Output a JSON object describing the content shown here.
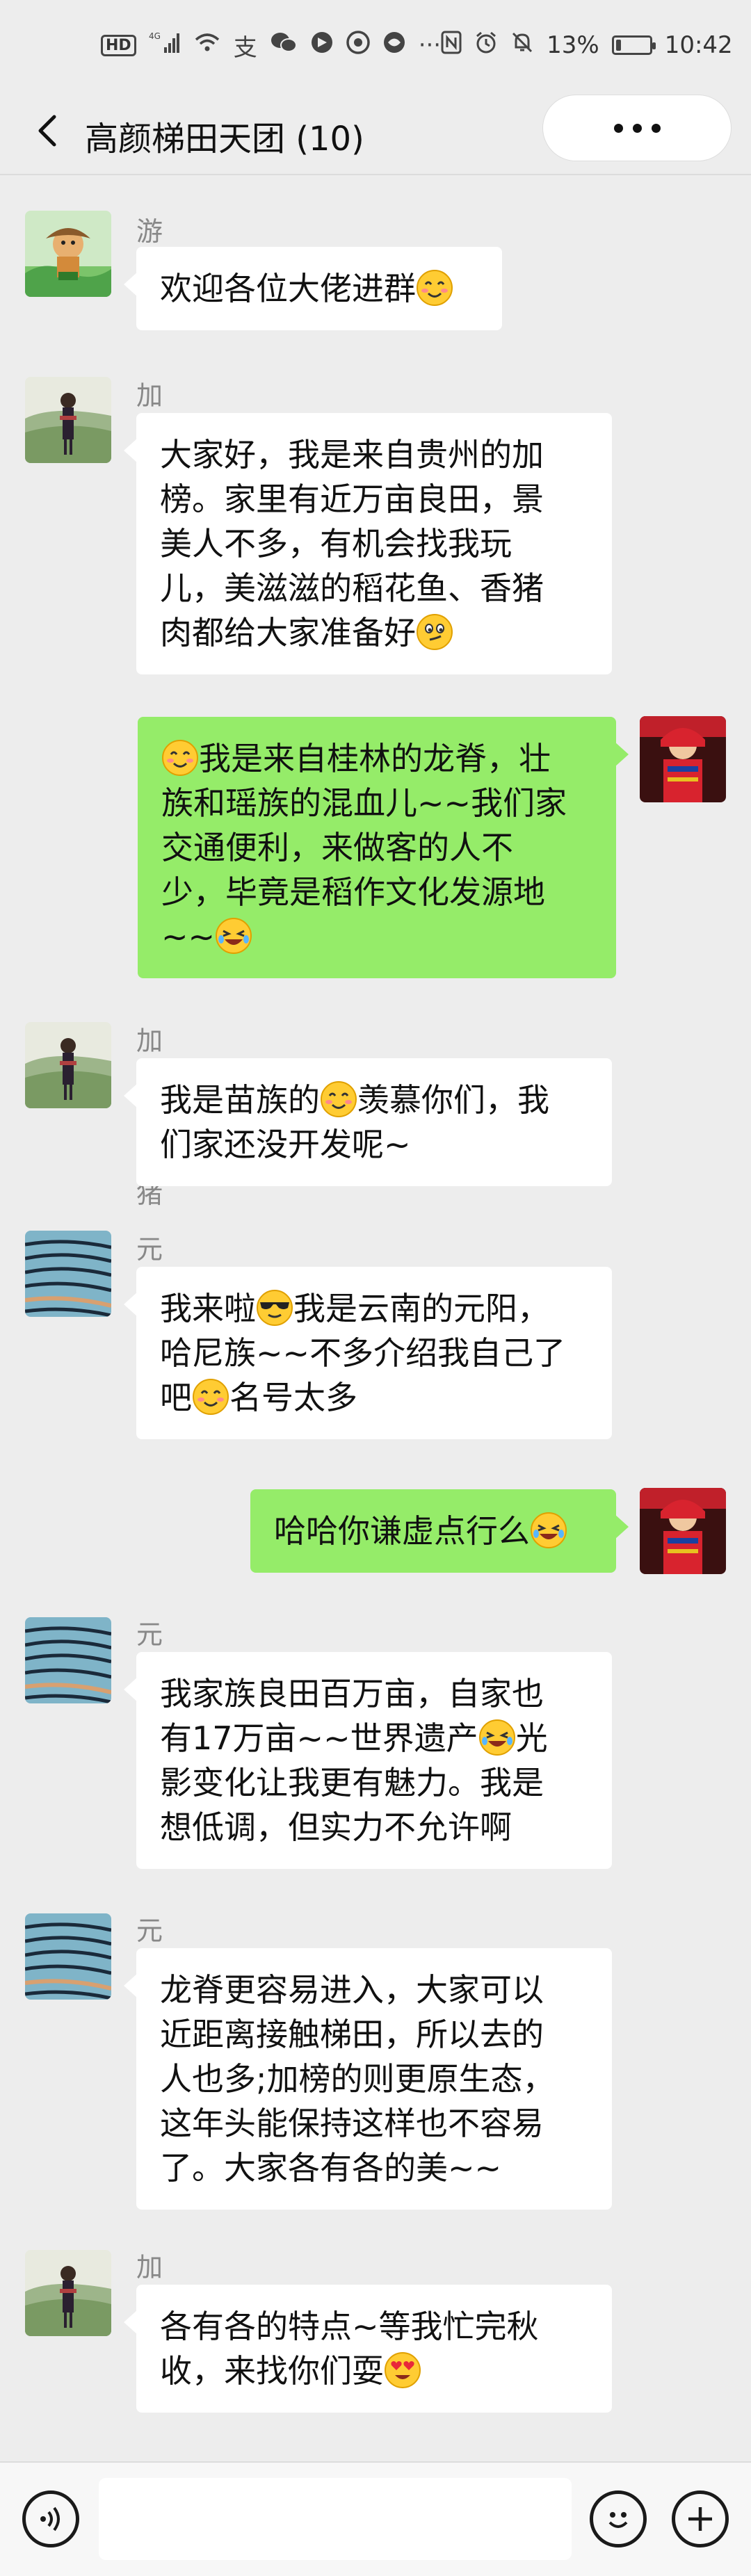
{
  "status_bar": {
    "left_icons": [
      "hd-icon",
      "signal-4g-icon",
      "wifi-icon",
      "alipay-icon",
      "wechat-icon",
      "app-icon",
      "chrome-icon",
      "browser-icon",
      "more-icon"
    ],
    "hd_badge": "HD",
    "net_label": "4G",
    "battery": "13%",
    "time": "10:42",
    "battery_level": 0.13
  },
  "header": {
    "title": "高颜梯田天团 (10)"
  },
  "messages": [
    {
      "sender": "游大侠",
      "side": "in",
      "text": "欢迎各位大佬进群",
      "emoji": "smile-blush",
      "avatar": "cartoon"
    },
    {
      "sender": "加榜小香猪",
      "side": "in",
      "text": "大家好，我是来自贵州的加榜。家里有近万亩良田，景美人不多，有机会找我玩儿，美滋滋的稻花鱼、香猪肉都给大家准备好",
      "emoji": "smirk",
      "avatar": "miao"
    },
    {
      "sender": "",
      "side": "out",
      "text_pre": "",
      "text": "我是来自桂林的龙脊，壮族和瑶族的混血儿~~我们家交通便利，来做客的人不少，毕竟是稻作文化发源地~~",
      "emoji": "laugh",
      "avatar": "red"
    },
    {
      "sender": "加榜小香猪",
      "side": "in",
      "text": "我是苗族的羡慕你们，我们家还没开发呢~",
      "emoji": "smile-blush",
      "avatar": "miao"
    },
    {
      "sender": "元阳",
      "side": "in",
      "text": "我来啦我是云南的元阳，哈尼族~~不多介绍我自己了吧名号太多",
      "emoji": "cool",
      "avatar": "terrace"
    },
    {
      "sender": "",
      "side": "out",
      "text": "哈哈你谦虚点行么",
      "emoji": "laugh",
      "avatar": "red"
    },
    {
      "sender": "元阳",
      "side": "in",
      "text": "我家族良田百万亩，自家也有17万亩~~世界遗产光影变化让我更有魅力。我是想低调，但实力不允许啊",
      "emoji": "laugh",
      "avatar": "terrace"
    },
    {
      "sender": "元阳",
      "side": "in",
      "text": "龙脊更容易进入，大家可以近距离接触梯田，所以去的人也多;加榜的则更原生态，这年头能保持这样也不容易了。大家各有各的美~~",
      "emoji": "",
      "avatar": "terrace"
    },
    {
      "sender": "加榜",
      "side": "in",
      "text": "各有各的特点~等我忙完秋收，来找你们耍",
      "emoji": "heart-eyes",
      "avatar": "miao"
    }
  ],
  "lines": {
    "m0": [
      "欢迎各位大佬进群"
    ],
    "m1": [
      "大家好，我是来自贵州的加",
      "榜。家里有近万亩良田，景",
      "美人不多，有机会找我玩",
      "儿，美滋滋的稻花鱼、香猪",
      "肉都给大家准备好"
    ],
    "m2": [
      "我是来自桂林的龙脊，壮",
      "族和瑶族的混血儿~~我们家",
      "交通便利，来做客的人不",
      "少，毕竟是稻作文化发源地",
      "~~"
    ],
    "m3a": "我是苗族的",
    "m3b": "羡慕你们，我",
    "m3c": "们家还没开发呢~",
    "m4a": "我来啦",
    "m4b": "我是云南的元阳，",
    "m4c": "哈尼族~~不多介绍我自己了",
    "m4d": "吧",
    "m4e": "名号太多",
    "m5": "哈哈你谦虚点行么",
    "m6a": "我家族良田百万亩，自家也",
    "m6b": "有17万亩~~世界遗产",
    "m6c": "光",
    "m6d": "影变化让我更有魅力。我是",
    "m6e": "想低调，但实力不允许啊",
    "m7": [
      "龙脊更容易进入，大家可以",
      "近距离接触梯田，所以去的",
      "人也多;加榜的则更原生态，",
      "这年头能保持这样也不容易",
      "了。大家各有各的美~~"
    ],
    "m8a": "各有各的特点~等我忙完秋",
    "m8b": "收，来找你们耍"
  },
  "input_bar": {
    "voice_icon": "voice-icon",
    "emoji_icon": "emoji-icon",
    "plus_icon": "plus-icon",
    "text_value": ""
  }
}
